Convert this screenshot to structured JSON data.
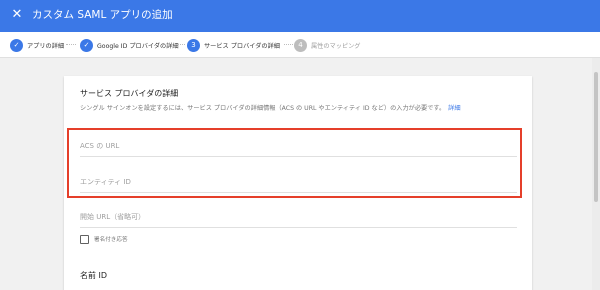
{
  "header": {
    "close_icon": "close-icon",
    "title": "カスタム SAML アプリの追加"
  },
  "stepper": {
    "steps": [
      {
        "label": "アプリの詳細",
        "state": "done",
        "icon": "check-icon"
      },
      {
        "label": "Google ID プロバイダの詳細",
        "state": "done",
        "icon": "check-icon"
      },
      {
        "label": "サービス プロバイダの詳細",
        "state": "current",
        "number": "3"
      },
      {
        "label": "属性のマッピング",
        "state": "upcoming",
        "number": "4"
      }
    ]
  },
  "section": {
    "heading": "サービス プロバイダの詳細",
    "description": "シングル サインオンを設定するには、サービス プロバイダの詳細情報（ACS の URL やエンティティ ID など）の入力が必要です。",
    "link": "詳細"
  },
  "fields": {
    "acs_url_placeholder": "ACS の URL",
    "entity_id_placeholder": "エンティティ ID",
    "start_url_placeholder": "開始 URL（省略可）"
  },
  "checkbox": {
    "label": "署名付き応答",
    "checked": false
  },
  "name_id": {
    "heading": "名前 ID"
  },
  "colors": {
    "topbar": "#3b78e7",
    "highlight": "#e53f2a"
  }
}
